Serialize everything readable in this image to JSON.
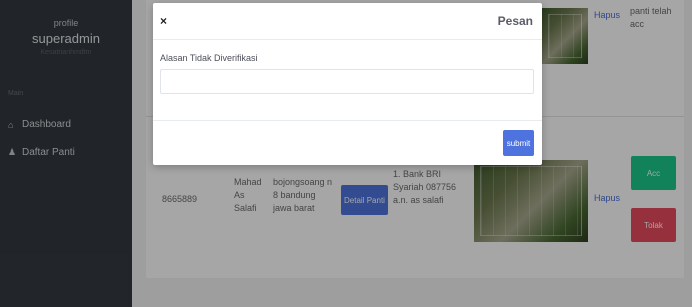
{
  "sidebar": {
    "profile_label": "profile",
    "username": "superadmin",
    "address": "Kesatrianhmdtm",
    "section_label": "Main",
    "items": [
      {
        "label": "Dashboard",
        "icon": "home-icon"
      },
      {
        "label": "Daftar Panti",
        "icon": "person-icon"
      }
    ]
  },
  "table": {
    "row1": {
      "hapus_label": "Hapus",
      "status_text": "panti telah acc"
    },
    "row2": {
      "id": "8665889",
      "name": "Mahad As Salafi",
      "address": "bojongsoang n 8 bandung jawa barat",
      "detail_button": "Detail Panti",
      "bank": "1. Bank BRI Syariah 087756 a.n. as salafi",
      "hapus_label": "Hapus",
      "accept_button": "Acc",
      "reject_button": "Tolak"
    }
  },
  "modal": {
    "close_label": "×",
    "title": "Pesan",
    "field_label": "Alasan Tidak Diverifikasi",
    "field_value": "",
    "submit_label": "submit"
  },
  "colors": {
    "sidebar_bg": "#343a40",
    "primary": "#4e73df",
    "success": "#1cc88a",
    "danger": "#e74a5f"
  }
}
